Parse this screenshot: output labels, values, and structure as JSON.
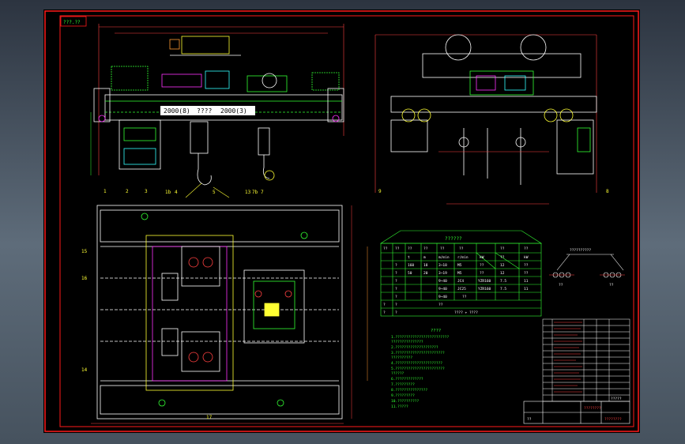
{
  "drawing": {
    "stamp_top_left": "???.??",
    "side_view_labels": {
      "left_dim": "2000(8)",
      "right_dim": "2000(3)",
      "middle": "????"
    },
    "callouts_front": [
      "1b",
      "4",
      "5",
      "13",
      "7b",
      "7"
    ],
    "callouts_side": [
      "9",
      "8"
    ],
    "callouts_plan": [
      "1",
      "2",
      "3",
      "15",
      "16",
      "14",
      "17"
    ],
    "param_table": {
      "title": "??????",
      "header_row_1": [
        "??",
        "??",
        "??",
        "??",
        "??",
        "??",
        "??",
        "??"
      ],
      "header_row_2": [
        "",
        "t",
        "m",
        "m/min",
        "r/min",
        "kW",
        "??",
        "kW"
      ],
      "rows": [
        [
          "?",
          "160",
          "18",
          "3~18",
          "M5",
          "??",
          "12",
          "??"
        ],
        [
          "?",
          "50",
          "20",
          "3~19",
          "M5",
          "??",
          "12",
          "??"
        ],
        [
          "?",
          "",
          "",
          "9~40",
          "JC4",
          "YZR160",
          "7.5",
          "11"
        ],
        [
          "?",
          "",
          "",
          "9~40",
          "JC25",
          "YZR160",
          "7.5",
          "11"
        ],
        [
          "?",
          "",
          "",
          "9~40",
          "",
          "",
          "",
          ""
        ],
        [
          "?",
          "?",
          "",
          "",
          "",
          "",
          "",
          ""
        ],
        [
          "?",
          "?",
          "",
          "",
          "",
          "",
          "",
          ""
        ]
      ],
      "footer_cells": [
        "??",
        "???? + ????"
      ],
      "footer_total": "??"
    },
    "notes": {
      "title": "????",
      "lines": [
        "1.?????????????????????????",
        "  ???????????????",
        "2.????????????????????",
        "3.???????????????????????",
        "  ??????????",
        "4.??????????????????????",
        "5.???????????????????????",
        "  ??????",
        "6.?????????????",
        "7.?????????",
        "8.???????????????",
        "9.?????????",
        "10.??????????",
        "11.?????"
      ]
    },
    "bom_title": "?????",
    "title_block": {
      "name": "????????",
      "drawing_no": "????????",
      "scale_label": "??"
    },
    "rope_diagram": {
      "label": "??????????",
      "left_tag": "??",
      "right_tag": "??"
    },
    "colors": {
      "frame": "#ff1a1a",
      "outline": "#ffffff",
      "dimension": "#ff4040",
      "green": "#33ff33",
      "yellow": "#ffff33",
      "cyan": "#33ffff",
      "magenta": "#ff33ff",
      "orange": "#ff9933"
    }
  }
}
